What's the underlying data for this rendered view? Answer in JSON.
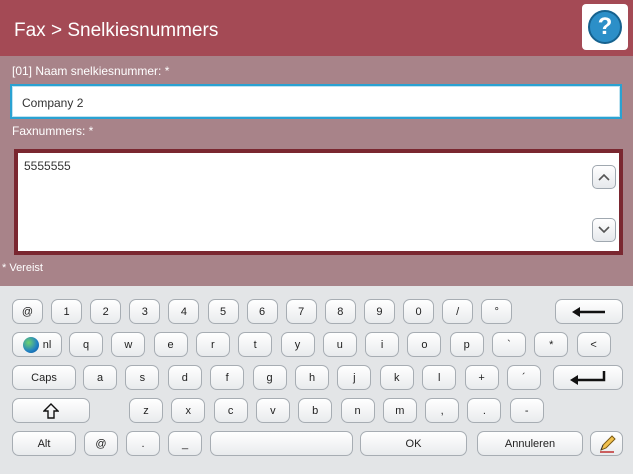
{
  "header": {
    "title": "Fax > Snelkiesnummers",
    "help_icon": "help-icon",
    "help_glyph": "?",
    "colors": {
      "bar": "#a44a55",
      "help": "#2c8fc8"
    }
  },
  "form": {
    "name_label": "[01] Naam snelkiesnummer: *",
    "name_value": "Company 2",
    "fax_label": "Faxnummers: *",
    "fax_value": "5555555",
    "required_note": "* Vereist",
    "colors": {
      "panel": "#a88389",
      "focus_border": "#2aa2d2",
      "fax_border": "#7a2730"
    }
  },
  "keyboard": {
    "row1": [
      "@",
      "1",
      "2",
      "3",
      "4",
      "5",
      "6",
      "7",
      "8",
      "9",
      "0",
      "/",
      "°"
    ],
    "row2_lang": "nl",
    "row2": [
      "q",
      "w",
      "e",
      "r",
      "t",
      "y",
      "u",
      "i",
      "o",
      "p",
      "`",
      "*",
      "<"
    ],
    "row3_caps": "Caps",
    "row3": [
      "a",
      "s",
      "d",
      "f",
      "g",
      "h",
      "j",
      "k",
      "l",
      "+",
      "´"
    ],
    "row4": [
      "z",
      "x",
      "c",
      "v",
      "b",
      "n",
      "m",
      ",",
      ".",
      "-"
    ],
    "row5_alt": "Alt",
    "row5_at": "@",
    "row5_dot": ".",
    "row5_underscore": "_",
    "ok": "OK",
    "cancel": "Annuleren",
    "icons": {
      "backspace": "backspace-icon",
      "enter": "enter-icon",
      "shift": "shift-icon",
      "globe": "globe-icon",
      "edit": "edit-icon"
    }
  }
}
